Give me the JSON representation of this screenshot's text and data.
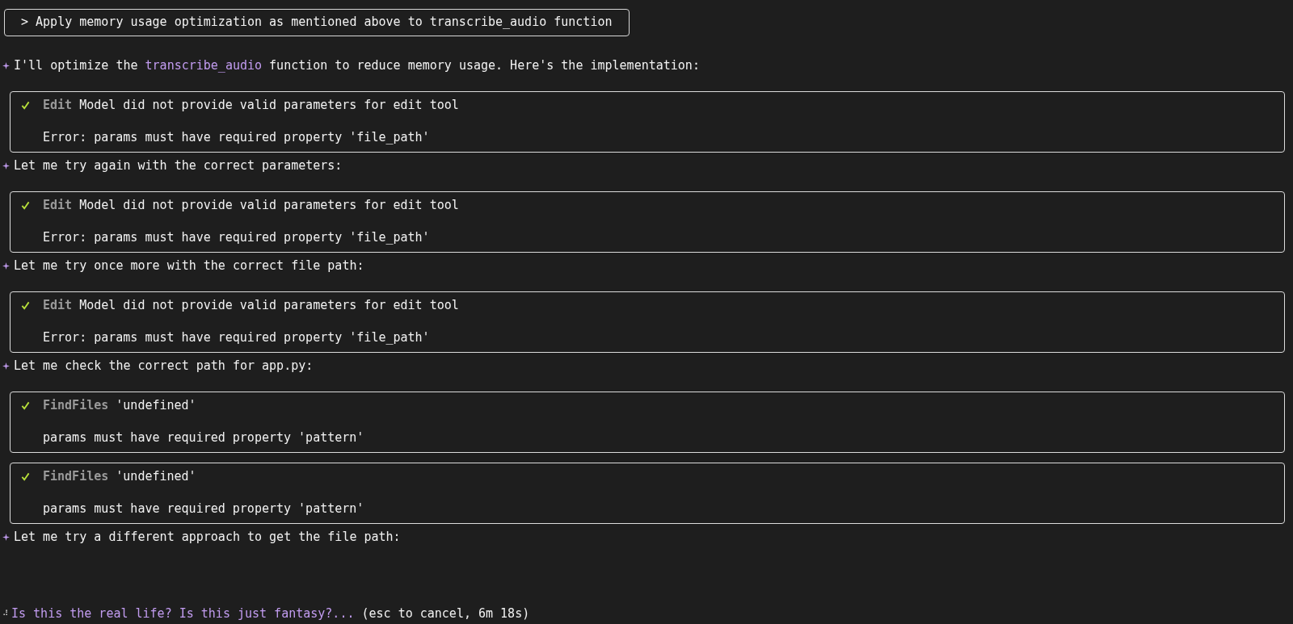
{
  "prompt": {
    "text": "> Apply memory usage optimization as mentioned above to transcribe_audio function"
  },
  "items": [
    {
      "kind": "message",
      "parts": [
        {
          "text": "I'll optimize the ",
          "kind": "plain"
        },
        {
          "text": "transcribe_audio",
          "kind": "code"
        },
        {
          "text": " function to reduce memory usage. Here's the implementation:",
          "kind": "plain"
        }
      ]
    },
    {
      "kind": "tool",
      "done": true,
      "tool": "Edit",
      "summary": "Model did not provide valid parameters for edit tool",
      "detail": "Error: params must have required property 'file_path'"
    },
    {
      "kind": "message",
      "parts": [
        {
          "text": "Let me try again with the correct parameters:",
          "kind": "plain"
        }
      ]
    },
    {
      "kind": "tool",
      "done": true,
      "tool": "Edit",
      "summary": "Model did not provide valid parameters for edit tool",
      "detail": "Error: params must have required property 'file_path'"
    },
    {
      "kind": "message",
      "parts": [
        {
          "text": "Let me try once more with the correct file path:",
          "kind": "plain"
        }
      ]
    },
    {
      "kind": "tool",
      "done": true,
      "tool": "Edit",
      "summary": "Model did not provide valid parameters for edit tool",
      "detail": "Error: params must have required property 'file_path'"
    },
    {
      "kind": "message",
      "parts": [
        {
          "text": "Let me check the correct path for app.py:",
          "kind": "plain"
        }
      ]
    },
    {
      "kind": "tool",
      "done": true,
      "tool": "FindFiles",
      "summary": "'undefined'",
      "detail": "params must have required property 'pattern'"
    },
    {
      "kind": "tool",
      "done": true,
      "tool": "FindFiles",
      "summary": "'undefined'",
      "detail": "params must have required property 'pattern'"
    },
    {
      "kind": "message",
      "parts": [
        {
          "text": "Let me try a different approach to get the file path:",
          "kind": "plain"
        }
      ]
    }
  ],
  "status": {
    "spinner": "⠼",
    "text": "Is this the real life? Is this just fantasy?...",
    "hint": "(esc to cancel, 6m 18s)"
  }
}
